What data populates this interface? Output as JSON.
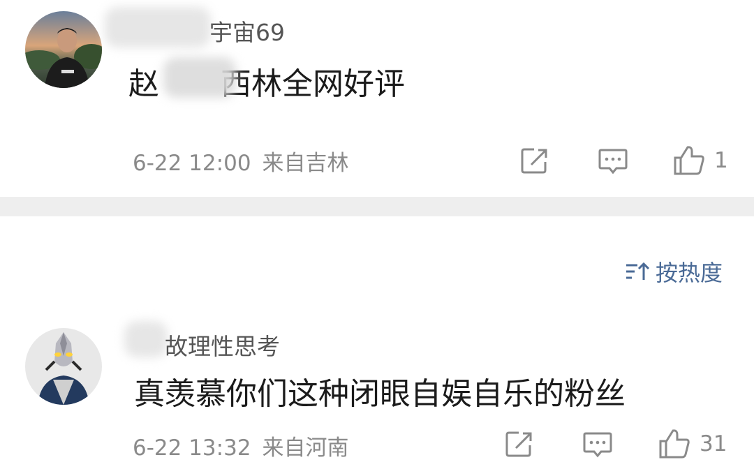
{
  "comments": [
    {
      "username": "宇宙69",
      "text": "赵　　西林全网好评",
      "time": "6-22 12:00",
      "location": "来自吉林",
      "likes": "1"
    },
    {
      "username": "故理性思考",
      "text": "真羡慕你们这种闭眼自娱自乐的粉丝",
      "time": "6-22 13:32",
      "location": "来自河南",
      "likes": "31"
    }
  ],
  "sort": {
    "label": "按热度"
  },
  "icons": {
    "share": "share-icon",
    "reply": "comment-icon",
    "like": "thumbs-up-icon",
    "sort": "sort-icon"
  },
  "colors": {
    "sort_accent": "#4a6a96",
    "meta_text": "#8a8a8a",
    "divider": "#eeeeee"
  }
}
